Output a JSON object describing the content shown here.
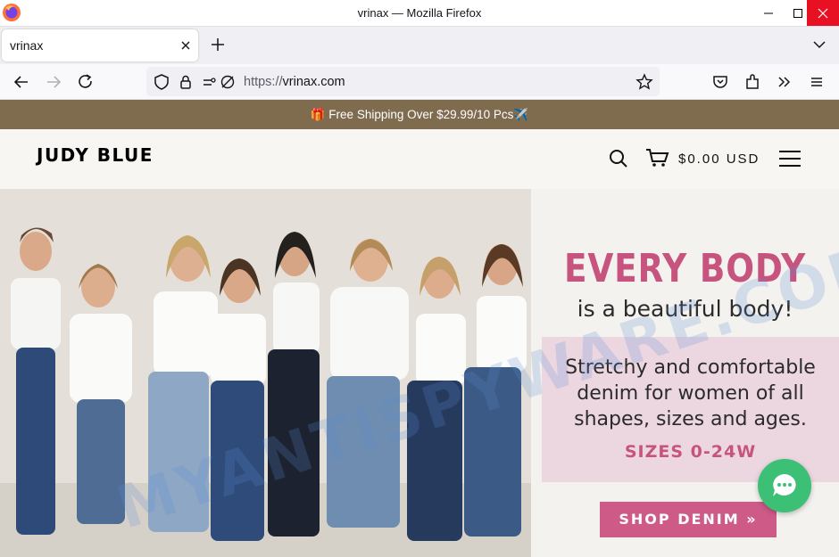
{
  "window": {
    "title": "vrinax — Mozilla Firefox"
  },
  "tab": {
    "title": "vrinax"
  },
  "urlbar": {
    "prefix": "https://",
    "domain": "vrinax.com"
  },
  "announcement": {
    "text": "🎁 Free Shipping Over $29.99/10 Pcs✈️"
  },
  "header": {
    "logo": "JUDY BLUE",
    "cart_total": "$0.00 USD"
  },
  "hero": {
    "headline": "EVERY BODY",
    "subheadline": "is a beautiful body!",
    "body_lines": [
      "Stretchy and comfortable",
      "denim for women of all",
      "shapes, sizes and ages."
    ],
    "sizes": "SIZES 0-24W",
    "cta": "SHOP DENIM »"
  },
  "watermark": {
    "text": "MYANTISPYWARE.COM"
  },
  "colors": {
    "accent_pink": "#c7547e",
    "announce_bar": "#7f6c4e",
    "chat_green": "#3cc076",
    "close_red": "#e81123"
  },
  "icons": [
    "firefox-logo",
    "close-icon",
    "plus-icon",
    "chevron-down-icon",
    "back-icon",
    "forward-icon",
    "reload-icon",
    "shield-icon",
    "lock-icon",
    "permissions-icon",
    "star-icon",
    "pocket-icon",
    "extensions-icon",
    "overflow-icon",
    "menu-icon",
    "search-icon",
    "cart-icon",
    "hamburger-icon",
    "chat-icon"
  ]
}
